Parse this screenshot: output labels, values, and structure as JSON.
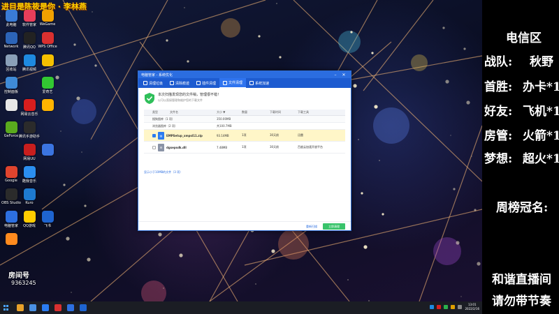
{
  "stream": {
    "banner": "进目是陈筱是你 · 李林燕",
    "room_label": "房间号",
    "room_number": "9363245"
  },
  "side_panel": {
    "region": "电信区",
    "team_label": "战队:",
    "team_value": "秋野",
    "first_win_label": "首胜:",
    "first_win_value": "办卡*1",
    "friend_label": "好友:",
    "friend_value": "飞机*1",
    "room_manager_label": "房管:",
    "room_manager_value": "火箭*1",
    "dream_label": "梦想:",
    "dream_value": "超火*1",
    "weekly_label": "周榜冠名:",
    "footer_line1": "和谐直播间",
    "footer_line2": "请勿带节奏"
  },
  "desktop_icons": [
    {
      "label": "此电脑",
      "color": "#3a7bd5"
    },
    {
      "label": "Network",
      "color": "#2c64b8"
    },
    {
      "label": "回收站",
      "color": "#8aa0b8"
    },
    {
      "label": "控制面板",
      "color": "#3f8ad6"
    },
    {
      "label": "",
      "color": "#e8e8e8"
    },
    {
      "label": "GeForce",
      "color": "#5aaa1e"
    },
    {
      "label": "Google",
      "color": "#e0442e"
    },
    {
      "label": "OBS Studio",
      "color": "#2b2b2b"
    },
    {
      "label": "电脑管家",
      "color": "#2d6fe0"
    },
    {
      "label": "",
      "color": "#ff8a1e"
    },
    {
      "label": "软件管家",
      "color": "#e83e5a"
    },
    {
      "label": "腾讯QQ",
      "color": "#222"
    },
    {
      "label": "腾讯视频",
      "color": "#1e8ae0"
    },
    {
      "label": "网易云音乐",
      "color": "#d81e1e"
    },
    {
      "label": "腾讯手游助手",
      "color": "#2b2b2b"
    },
    {
      "label": "网易UU",
      "color": "#c81e1e"
    },
    {
      "label": "酷我音乐",
      "color": "#2b8ef0"
    },
    {
      "label": "Kuro",
      "color": "#1e7ad0"
    },
    {
      "label": "QQ游戏",
      "color": "#ffcc00"
    },
    {
      "label": "WeGame",
      "color": "#f0a000"
    },
    {
      "label": "WPS Office",
      "color": "#d93030"
    },
    {
      "label": "",
      "color": "#f5c000"
    },
    {
      "label": "爱奇艺",
      "color": "#32c832"
    },
    {
      "label": "",
      "color": "#ffb400"
    },
    {
      "label": "",
      "color": "#3b74e0"
    },
    {
      "label": "飞书",
      "color": "#1e64d0"
    }
  ],
  "window": {
    "title": "电脑管家 - 系统优化",
    "tabs": [
      {
        "label": "清理垃圾",
        "active": false
      },
      {
        "label": "清除痕迹",
        "active": false
      },
      {
        "label": "插件清理",
        "active": false
      },
      {
        "label": "文件清理",
        "active": true
      },
      {
        "label": "系统加速",
        "active": false
      }
    ],
    "notice_title": "本次扫描发现您的文件稍，管理很不错！",
    "notice_sub": "以可以直接管理和维护您的下载文件",
    "columns": [
      "类型",
      "文件名",
      "大小 ▼",
      "数量",
      "下载时间",
      "下载工具"
    ],
    "groups": [
      {
        "label": "搜狗图库（1 项）",
        "size": "350.00MB"
      },
      {
        "label": "浏览器图库（2 项）",
        "size": "共100.7MB"
      }
    ],
    "files": [
      {
        "name": "EMPSetup_xmpsl11.zip",
        "size": "93.14MB",
        "count": "1项",
        "time": "30天前",
        "tool": "迅雷",
        "icon_color": "#2b7cf0",
        "checked": true
      },
      {
        "name": "dgsepsdk.dll",
        "size": "7.48MB",
        "count": "1项",
        "time": "30天前",
        "tool": "百度云加速开放平台",
        "icon_color": "#8a93a6",
        "checked": false
      }
    ],
    "show_files_link": "显示小于10MB的文件（3 项）",
    "view_link": "重新扫描",
    "clean_button": "立即清理"
  },
  "taskbar": {
    "time": "13:01",
    "date": "2022/2/16"
  }
}
